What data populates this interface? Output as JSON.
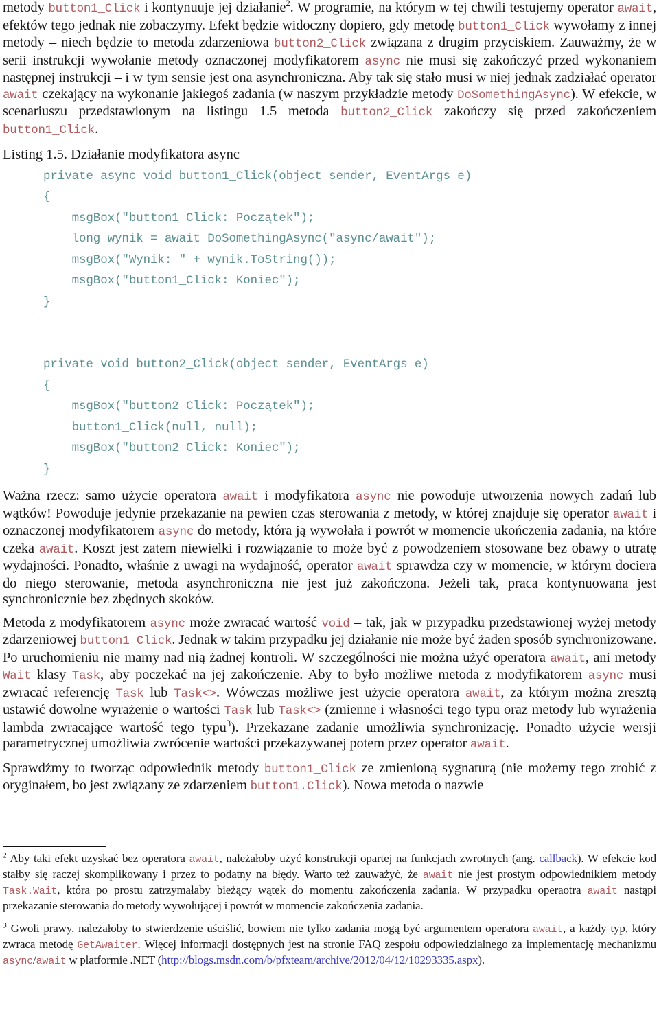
{
  "document": {
    "language": "pl",
    "colors": {
      "body_text": "#1a1a1a",
      "inline_code": "#b05a5e",
      "code_block": "#5c8f90",
      "link": "#3a3ac4",
      "background": "#ffffff"
    }
  },
  "paragraphs": {
    "p1": {
      "seg1": "metody ",
      "code1": "button1_Click",
      "seg2": " i kontynuuje jej działanie",
      "sup1": "2",
      "seg3": ". W programie, na którym w tej chwili testujemy operator ",
      "code2": "await",
      "seg4": ", efektów tego jednak nie zobaczymy. Efekt będzie widoczny dopiero, gdy metodę ",
      "code3": "button1_Click",
      "seg5": " wywołamy z innej metody – niech będzie to metoda zdarzeniowa ",
      "code4": "button2_Click",
      "seg6": " związana z drugim przyciskiem. Zauważmy, że w serii instrukcji wywołanie metody oznaczonej modyfikatorem ",
      "code5": "async",
      "seg7": " nie musi się zakończyć przed wykonaniem następnej instrukcji – i w tym sensie jest ona asynchroniczna. Aby tak się stało musi w niej jednak zadziałać operator ",
      "code6": "await",
      "seg8": " czekający na wykonanie jakiegoś zadania (w naszym przykładzie metody ",
      "code7": "DoSomethingAsync",
      "seg9": "). W efekcie, w scenariuszu przedstawionym na listingu 1.5 metoda ",
      "code8": "button2_Click",
      "seg10": " zakończy się przed zakończeniem ",
      "code9": "button1_Click",
      "seg11": "."
    },
    "p2": {
      "seg1": "Ważna rzecz: samo użycie operatora ",
      "code1": "await",
      "seg2": " i modyfikatora ",
      "code2": "async",
      "seg3": " nie powoduje utworzenia nowych zadań lub wątków! Powoduje jedynie przekazanie na pewien czas sterowania z metody, w której znajduje się operator ",
      "code3": "await",
      "seg4": " i oznaczonej modyfikatorem ",
      "code4": "async",
      "seg5": " do metody, która ją wywołała i powrót w momencie ukończenia zadania, na które czeka ",
      "code5": "await",
      "seg6": ". Koszt jest zatem niewielki i rozwiązanie to może być z powodzeniem stosowane bez obawy o utratę wydajności. Ponadto, właśnie z uwagi na wydajność, operator ",
      "code6": "await",
      "seg7": " sprawdza czy w momencie, w którym dociera do niego sterowanie, metoda asynchroniczna nie jest już zakończona. Jeżeli tak, praca kontynuowana jest synchronicznie bez zbędnych skoków."
    },
    "p3": {
      "seg1": "Metoda z modyfikatorem ",
      "code1": "async",
      "seg2": " może zwracać wartość ",
      "code2": "void",
      "seg3": " – tak, jak w przypadku przedstawionej wyżej metody zdarzeniowej ",
      "code3": "button1_Click",
      "seg4": ". Jednak w takim przypadku jej działanie nie może być żaden sposób synchronizowane. Po uruchomieniu nie mamy nad nią żadnej kontroli. W szczególności nie można użyć operatora ",
      "code4": "await",
      "seg5": ", ani metody ",
      "code5": "Wait",
      "seg6": " klasy ",
      "code6": "Task",
      "seg7": ", aby poczekać na jej zakończenie. Aby to było możliwe metoda z modyfikatorem ",
      "code7": "async",
      "seg8": " musi zwracać referencję ",
      "code8": "Task",
      "seg9": " lub ",
      "code9": "Task<>",
      "seg10": ". Wówczas możliwe jest użycie operatora ",
      "code10": "await",
      "seg11": ", za którym można zresztą ustawić dowolne wyrażenie o wartości ",
      "code11": "Task",
      "seg12": " lub ",
      "code12": "Task<>",
      "seg13": " (zmienne i własności tego typu oraz metody lub wyrażenia lambda zwracające wartość tego typu",
      "sup1": "3",
      "seg14": "). Przekazane zadanie umożliwia synchronizację. Ponadto użycie wersji parametrycznej umożliwia zwrócenie wartości przekazywanej potem przez operator ",
      "code13": "await",
      "seg15": "."
    },
    "p4": {
      "seg1": "Sprawdźmy to tworząc odpowiednik metody ",
      "code1": "button1_Click",
      "seg2": " ze zmienioną sygnaturą (nie możemy tego zrobić z oryginałem, bo jest związany ze zdarzeniem ",
      "code2": "button1.Click",
      "seg3": "). Nowa metoda o nazwie"
    }
  },
  "listing": {
    "caption": "Listing 1.5. Działanie modyfikatora async",
    "lines": [
      "private async void button1_Click(object sender, EventArgs e)",
      "{",
      "    msgBox(\"button1_Click: Początek\");",
      "    long wynik = await DoSomethingAsync(\"async/await\");",
      "    msgBox(\"Wynik: \" + wynik.ToString());",
      "    msgBox(\"button1_Click: Koniec\");",
      "}",
      "",
      "",
      "private void button2_Click(object sender, EventArgs e)",
      "{",
      "    msgBox(\"button2_Click: Początek\");",
      "    button1_Click(null, null);",
      "    msgBox(\"button2_Click: Koniec\");",
      "}"
    ]
  },
  "footnotes": {
    "fn2": {
      "marker": "2",
      "seg1": " Aby taki efekt uzyskać bez operatora ",
      "code1": "await",
      "seg2": ", należałoby użyć konstrukcji opartej na funkcjach zwrotnych (ang. ",
      "link1": "callback",
      "seg3": "). W efekcie kod stałby się raczej skomplikowany i przez to podatny na błędy. Warto też zauważyć, że ",
      "code2": "await",
      "seg4": " nie jest prostym odpowiednikiem metody ",
      "code3": "Task.Wait",
      "seg5": ", która po prostu zatrzymałaby bieżący wątek do momentu zakończenia zadania. W przypadku operaotra ",
      "code4": "await",
      "seg6": " nastąpi przekazanie sterowania do metody wywołującej i powrót w momencie zakończenia zadania."
    },
    "fn3": {
      "marker": "3",
      "seg1": " Gwoli prawy, należałoby to stwierdzenie uściślić, bowiem nie tylko zadania mogą być argumentem operatora ",
      "code1": "await",
      "seg2": ", a każdy typ, który zwraca metodę ",
      "code2": "GetAwaiter",
      "seg3": ". Więcej informacji dostępnych jest na stronie FAQ zespołu odpowiedzialnego za implementację mechanizmu ",
      "code3": "async",
      "seg4": "/",
      "code4": "await",
      "seg5": " w platformie .NET (",
      "link1": "http://blogs.msdn.com/b/pfxteam/archive/2012/04/12/10293335.aspx",
      "seg6": ")."
    }
  }
}
